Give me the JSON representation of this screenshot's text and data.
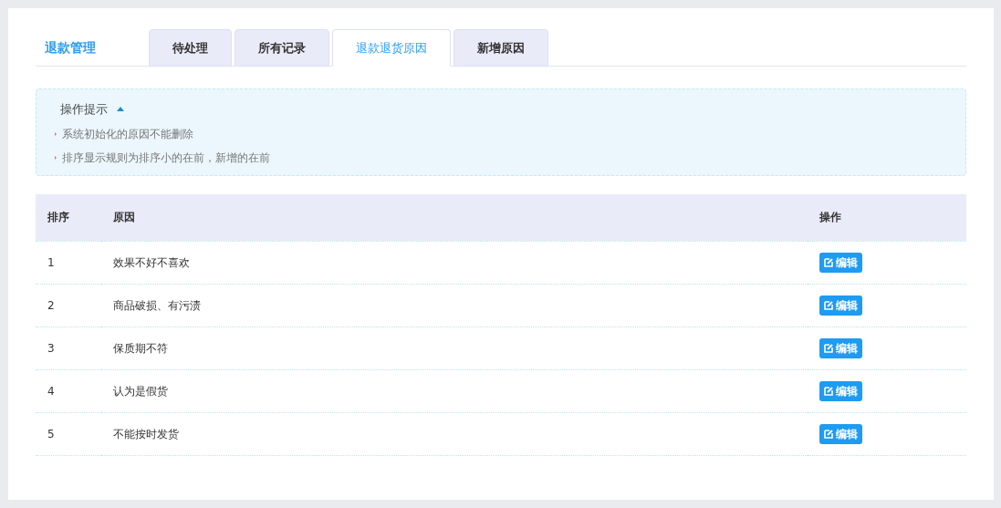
{
  "page_title": "退款管理",
  "tabs": [
    {
      "label": "待处理",
      "selected": false
    },
    {
      "label": "所有记录",
      "selected": false
    },
    {
      "label": "退款退货原因",
      "selected": true
    },
    {
      "label": "新增原因",
      "selected": false
    }
  ],
  "tips": {
    "title": "操作提示",
    "expanded": true,
    "items": [
      "系统初始化的原因不能删除",
      "排序显示规则为排序小的在前，新增的在前"
    ]
  },
  "table": {
    "columns": [
      "排序",
      "原因",
      "操作"
    ],
    "rows": [
      {
        "order": "1",
        "reason": "效果不好不喜欢",
        "action": "编辑"
      },
      {
        "order": "2",
        "reason": "商品破损、有污渍",
        "action": "编辑"
      },
      {
        "order": "3",
        "reason": "保质期不符",
        "action": "编辑"
      },
      {
        "order": "4",
        "reason": "认为是假货",
        "action": "编辑"
      },
      {
        "order": "5",
        "reason": "不能按时发货",
        "action": "编辑"
      }
    ]
  }
}
